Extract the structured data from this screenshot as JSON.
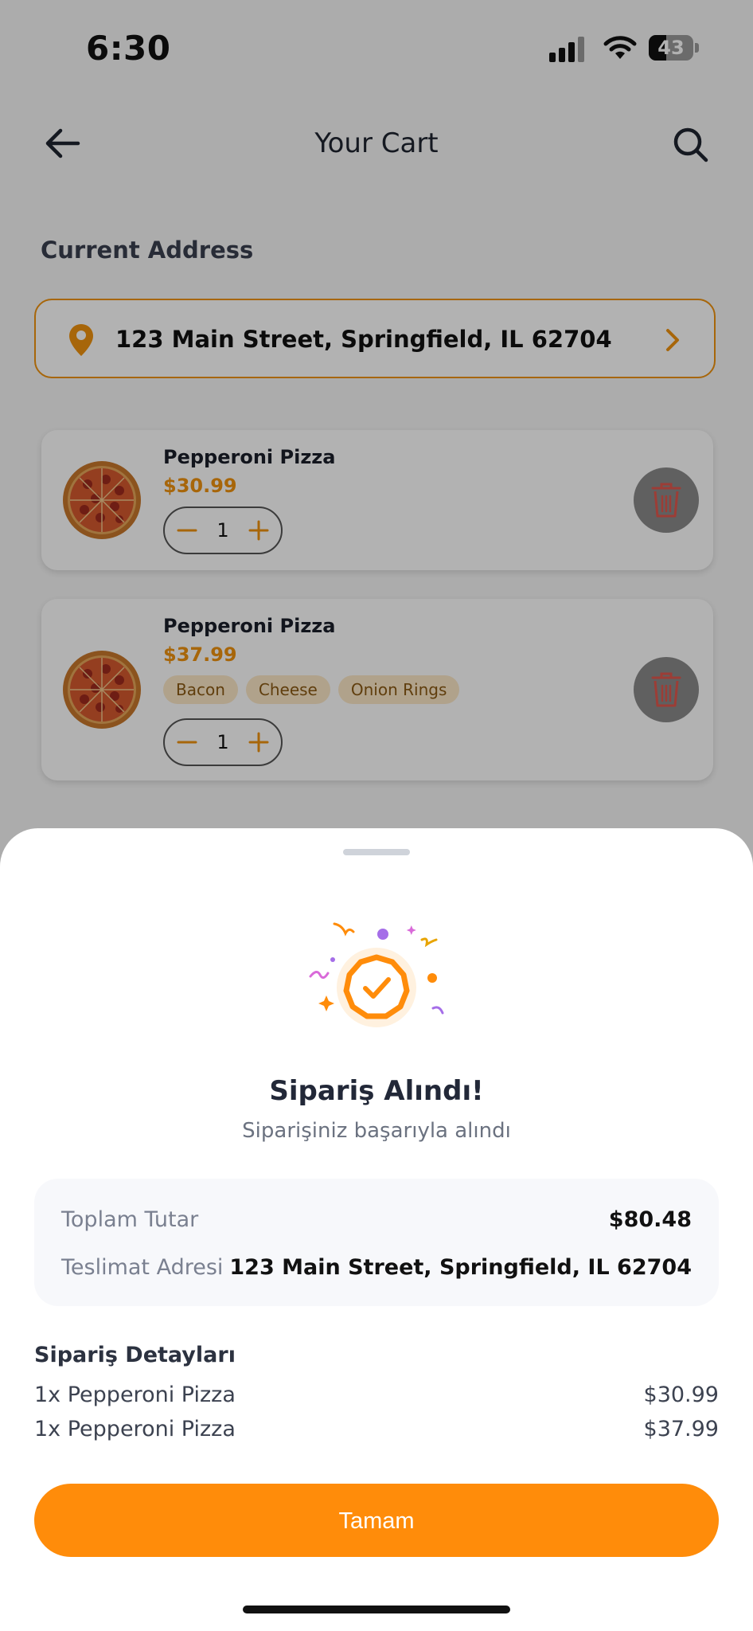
{
  "status_bar": {
    "time": "6:30",
    "battery": "43"
  },
  "header": {
    "title": "Your Cart",
    "back_icon": "arrow-left-icon",
    "search_icon": "search-icon"
  },
  "address": {
    "section_label": "Current Address",
    "value": "123 Main Street, Springfield, IL 62704"
  },
  "cart_items": [
    {
      "name": "Pepperoni Pizza",
      "price": "$30.99",
      "quantity": "1",
      "extras": []
    },
    {
      "name": "Pepperoni Pizza",
      "price": "$37.99",
      "quantity": "1",
      "extras": [
        "Bacon",
        "Cheese",
        "Onion Rings"
      ]
    }
  ],
  "sheet": {
    "title": "Sipariş Alındı!",
    "subtitle": "Siparişiniz başarıyla alındı",
    "summary": {
      "total_label": "Toplam Tutar",
      "total_value": "$80.48",
      "address_label": "Teslimat Adresi",
      "address_value": "123 Main Street, Springfield, IL 62704"
    },
    "details_title": "Sipariş Detayları",
    "details": [
      {
        "name": "1x Pepperoni Pizza",
        "price": "$30.99"
      },
      {
        "name": "1x Pepperoni Pizza",
        "price": "$37.99"
      }
    ],
    "button_label": "Tamam"
  },
  "colors": {
    "accent": "#ff8c0a",
    "price": "#f0920f",
    "tag_bg": "#fde8c8",
    "sheet_bg": "#ffffff"
  }
}
